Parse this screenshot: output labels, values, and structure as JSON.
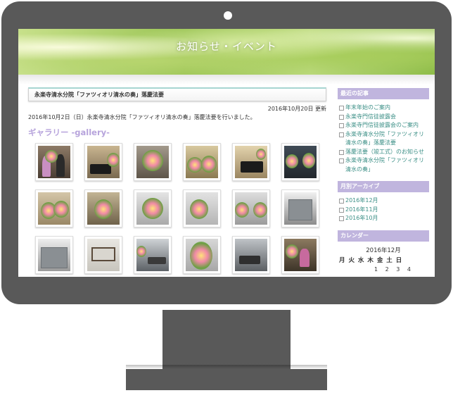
{
  "banner": {
    "title": "お知らせ・イベント"
  },
  "post": {
    "title": "永楽寺清水分院「ファツィオリ清水の奏」落慶法要",
    "date": "2016年10月20日 更新",
    "body": "2016年10月2日（日）永楽寺清水分院「ファツィオリ清水の奏」落慶法要を行いました。"
  },
  "gallery": {
    "heading": "ギャラリー -gallery-"
  },
  "sidebar": {
    "recent": {
      "heading": "最近の記事",
      "items": [
        "年末年始のご案内",
        "永楽寺門信徒披露会",
        "永楽寺門信徒披露会のご案内",
        "永楽寺清水分院「ファツィオリ清水の奏」落慶法要",
        "落慶法要（竣工式）のお知らせ",
        "永楽寺清水分院「ファツィオリ清水の奏」"
      ]
    },
    "archive": {
      "heading": "月別アーカイブ",
      "items": [
        "2016年12月",
        "2016年11月",
        "2016年10月"
      ]
    },
    "calendar": {
      "heading": "カレンダー",
      "month": "2016年12月",
      "weekdays": "月 火 水 木 金 土 日",
      "first_days": "1 2 3 4"
    }
  },
  "colors": {
    "monitor": "#595959",
    "accent_purple": "#c0b5de",
    "gallery_heading": "#b7a4dc",
    "link_teal": "#3b8f86"
  }
}
